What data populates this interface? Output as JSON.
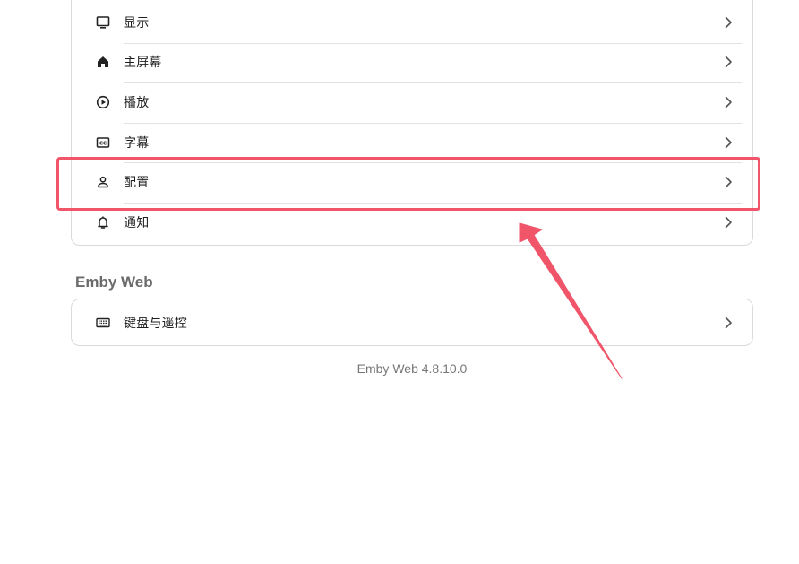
{
  "settings_list": {
    "items": [
      {
        "label": "显示",
        "icon": "monitor-icon"
      },
      {
        "label": "主屏幕",
        "icon": "home-icon"
      },
      {
        "label": "播放",
        "icon": "play-circle-icon"
      },
      {
        "label": "字幕",
        "icon": "closed-caption-icon"
      },
      {
        "label": "配置",
        "icon": "person-icon"
      },
      {
        "label": "通知",
        "icon": "bell-icon"
      }
    ]
  },
  "emby_web": {
    "title": "Emby Web",
    "items": [
      {
        "label": "键盘与遥控",
        "icon": "keyboard-icon"
      }
    ]
  },
  "footer": {
    "version": "Emby Web 4.8.10.0"
  },
  "annotation": {
    "highlight_color": "#f0556a",
    "highlighted_item": "配置"
  }
}
